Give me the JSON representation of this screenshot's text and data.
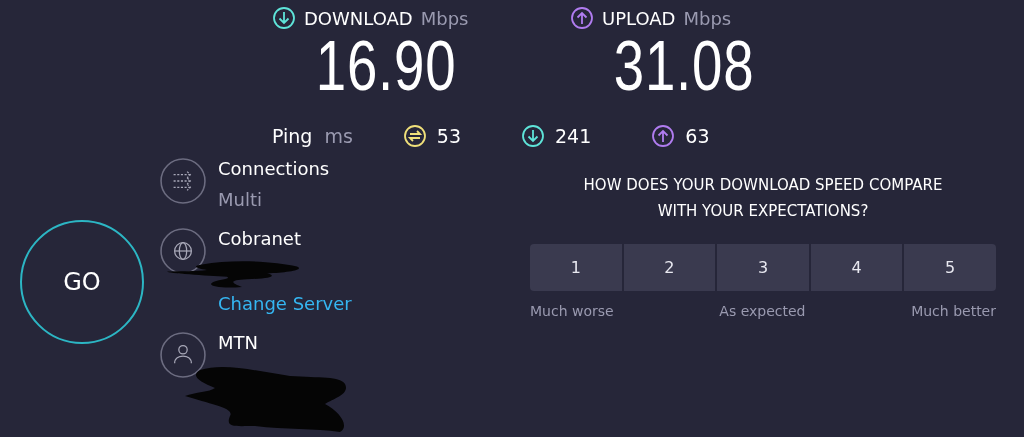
{
  "speeds": [
    {
      "kind": "download",
      "label": "DOWNLOAD",
      "unit": "Mbps",
      "value": "16.90"
    },
    {
      "kind": "upload",
      "label": "UPLOAD",
      "unit": "Mbps",
      "value": "31.08"
    }
  ],
  "ping": {
    "label": "Ping",
    "unit": "ms",
    "readings": [
      {
        "kind": "idle",
        "value": "53"
      },
      {
        "kind": "download",
        "value": "241"
      },
      {
        "kind": "upload",
        "value": "63"
      }
    ]
  },
  "go_button": "GO",
  "info": [
    {
      "kind": "connections",
      "title": "Connections",
      "subtitle": "Multi"
    },
    {
      "kind": "server",
      "title": "Cobranet",
      "link": "Change Server"
    },
    {
      "kind": "provider",
      "title": "MTN"
    }
  ],
  "survey": {
    "question": "HOW DOES YOUR DOWNLOAD SPEED COMPARE WITH YOUR EXPECTATIONS?",
    "options": [
      {
        "label": "1",
        "selected": false
      },
      {
        "label": "2",
        "selected": false
      },
      {
        "label": "3",
        "selected": false
      },
      {
        "label": "4",
        "selected": false
      },
      {
        "label": "5",
        "selected": false
      }
    ],
    "scale_labels": [
      "Much worse",
      "As expected",
      "Much better"
    ]
  }
}
